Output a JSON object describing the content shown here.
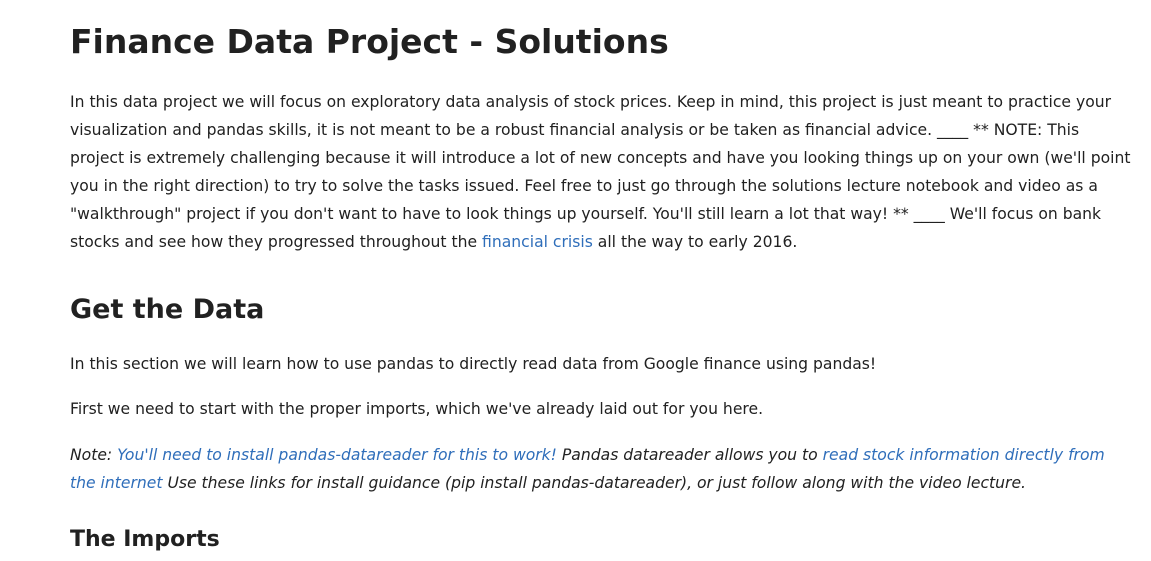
{
  "title": "Finance Data Project - Solutions",
  "intro": {
    "text_before_link": "In this data project we will focus on exploratory data analysis of stock prices. Keep in mind, this project is just meant to practice your visualization and pandas skills, it is not meant to be a robust financial analysis or be taken as financial advice. ____ ** NOTE: This project is extremely challenging because it will introduce a lot of new concepts and have you looking things up on your own (we'll point you in the right direction) to try to solve the tasks issued. Feel free to just go through the solutions lecture notebook and video as a \"walkthrough\" project if you don't want to have to look things up yourself. You'll still learn a lot that way! ** ____ We'll focus on bank stocks and see how they progressed throughout the ",
    "link_text": "financial crisis",
    "text_after_link": " all the way to early 2016."
  },
  "get_data": {
    "heading": "Get the Data",
    "paragraph1": "In this section we will learn how to use pandas to directly read data from Google finance using pandas!",
    "paragraph2": "First we need to start with the proper imports, which we've already laid out for you here.",
    "note": {
      "prefix": "Note: ",
      "link1": "You'll need to install pandas-datareader for this to work!",
      "middle": " Pandas datareader allows you to ",
      "link2": "read stock information directly from the internet",
      "suffix": " Use these links for install guidance (pip install pandas-datareader), or just follow along with the video lecture."
    }
  },
  "imports": {
    "heading": "The Imports"
  }
}
